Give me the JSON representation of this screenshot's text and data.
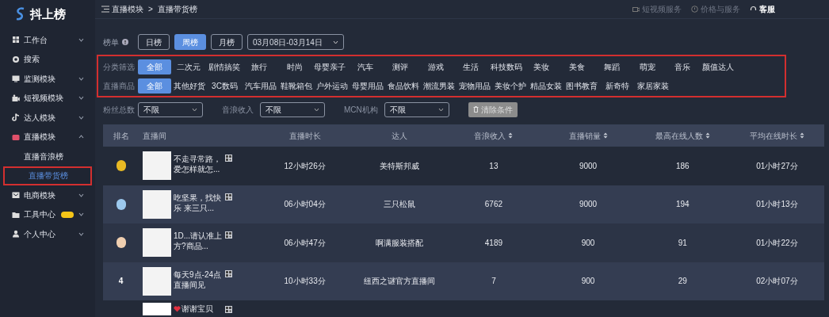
{
  "logo": {
    "text": "抖上榜"
  },
  "breadcrumb": [
    "直播模块",
    "直播带货榜"
  ],
  "breadcrumb_separator": ">",
  "top_links": [
    {
      "label": "短视频服务",
      "selected": false
    },
    {
      "label": "价格与服务",
      "selected": false
    },
    {
      "label": "客服",
      "selected": true
    }
  ],
  "sidebar": {
    "items": [
      {
        "label": "工作台",
        "expandable": true,
        "expanded": false,
        "badge": false
      },
      {
        "label": "搜索",
        "expandable": false,
        "badge": false
      },
      {
        "label": "监测模块",
        "expandable": true,
        "expanded": false,
        "badge": false
      },
      {
        "label": "短视频模块",
        "expandable": true,
        "expanded": false,
        "badge": false
      },
      {
        "label": "达人模块",
        "expandable": true,
        "expanded": false,
        "badge": false
      },
      {
        "label": "直播模块",
        "expandable": true,
        "expanded": true,
        "badge": false,
        "children": [
          {
            "label": "直播音浪榜",
            "selected": false
          },
          {
            "label": "直播带货榜",
            "selected": true
          }
        ]
      },
      {
        "label": "电商模块",
        "expandable": true,
        "expanded": false,
        "badge": false
      },
      {
        "label": "工具中心",
        "expandable": true,
        "expanded": false,
        "badge": true
      },
      {
        "label": "个人中心",
        "expandable": true,
        "expanded": false,
        "badge": false
      }
    ]
  },
  "ranking": {
    "label": "榜单",
    "periods": [
      {
        "label": "日榜",
        "selected": false
      },
      {
        "label": "周榜",
        "selected": true
      },
      {
        "label": "月榜",
        "selected": false
      }
    ],
    "date_range": "03月08日-03月14日"
  },
  "category_filter": {
    "label": "分类筛选",
    "options": [
      {
        "label": "全部",
        "selected": true
      },
      {
        "label": "二次元",
        "selected": false
      },
      {
        "label": "剧情搞笑",
        "selected": false
      },
      {
        "label": "旅行",
        "selected": false
      },
      {
        "label": "时尚",
        "selected": false
      },
      {
        "label": "母婴亲子",
        "selected": false
      },
      {
        "label": "汽车",
        "selected": false
      },
      {
        "label": "测评",
        "selected": false
      },
      {
        "label": "游戏",
        "selected": false
      },
      {
        "label": "生活",
        "selected": false
      },
      {
        "label": "科技数码",
        "selected": false
      },
      {
        "label": "美妆",
        "selected": false
      },
      {
        "label": "美食",
        "selected": false
      },
      {
        "label": "舞蹈",
        "selected": false
      },
      {
        "label": "萌宠",
        "selected": false
      },
      {
        "label": "音乐",
        "selected": false
      },
      {
        "label": "颜值达人",
        "selected": false
      }
    ]
  },
  "goods_filter": {
    "label": "直播商品",
    "options": [
      {
        "label": "全部",
        "selected": true
      },
      {
        "label": "其他好货",
        "selected": false
      },
      {
        "label": "3C数码",
        "selected": false
      },
      {
        "label": "汽车用品",
        "selected": false
      },
      {
        "label": "鞋靴箱包",
        "selected": false
      },
      {
        "label": "户外运动",
        "selected": false
      },
      {
        "label": "母婴用品",
        "selected": false
      },
      {
        "label": "食品饮料",
        "selected": false
      },
      {
        "label": "潮流男装",
        "selected": false
      },
      {
        "label": "宠物用品",
        "selected": false
      },
      {
        "label": "美妆个护",
        "selected": false
      },
      {
        "label": "精品女装",
        "selected": false
      },
      {
        "label": "图书教育",
        "selected": false
      },
      {
        "label": "新奇特",
        "selected": false
      },
      {
        "label": "家居家装",
        "selected": false
      }
    ]
  },
  "dropdown_filters": [
    {
      "label": "粉丝总数",
      "value": "不限"
    },
    {
      "label": "音浪收入",
      "value": "不限"
    },
    {
      "label": "MCN机构",
      "value": "不限"
    }
  ],
  "clear_button": {
    "label": "清除条件",
    "disabled": true
  },
  "table": {
    "columns": [
      {
        "label": "排名",
        "sortable": false
      },
      {
        "label": "直播间",
        "sortable": false
      },
      {
        "label": "直播时长",
        "sortable": false
      },
      {
        "label": "达人",
        "sortable": false
      },
      {
        "label": "音浪收入",
        "sortable": true
      },
      {
        "label": "直播销量",
        "sortable": true
      },
      {
        "label": "最高在线人数",
        "sortable": true
      },
      {
        "label": "平均在线时长",
        "sortable": true
      }
    ],
    "rows": [
      {
        "medal": true,
        "color": "#e8b923",
        "title": "不走寻常路，爱怎样就怎...",
        "duration": "12小时26分",
        "streamer": "美特斯邦威",
        "income": "13",
        "sales": "9000",
        "peak_viewers": "186",
        "avg_watch": "01小时27分"
      },
      {
        "medal": true,
        "color": "#9cc9ee",
        "title": "吃坚果，找快乐 来三只...",
        "duration": "06小时04分",
        "streamer": "三只松鼠",
        "income": "6762",
        "sales": "9000",
        "peak_viewers": "194",
        "avg_watch": "01小时13分"
      },
      {
        "medal": true,
        "color": "#f0cfb0",
        "title": "1D...请认准上方?商品...",
        "duration": "06小时47分",
        "streamer": "啊满服装搭配",
        "income": "4189",
        "sales": "900",
        "peak_viewers": "91",
        "avg_watch": "01小时22分"
      },
      {
        "medal": false,
        "rank": "4",
        "title": "每天9点-24点直播间见",
        "duration": "10小时33分",
        "streamer": "纽西之谜官方直播间",
        "income": "7",
        "sales": "900",
        "peak_viewers": "29",
        "avg_watch": "02小时07分"
      },
      {
        "medal": false,
        "title": "谢谢宝贝",
        "title_heart": true
      }
    ]
  }
}
